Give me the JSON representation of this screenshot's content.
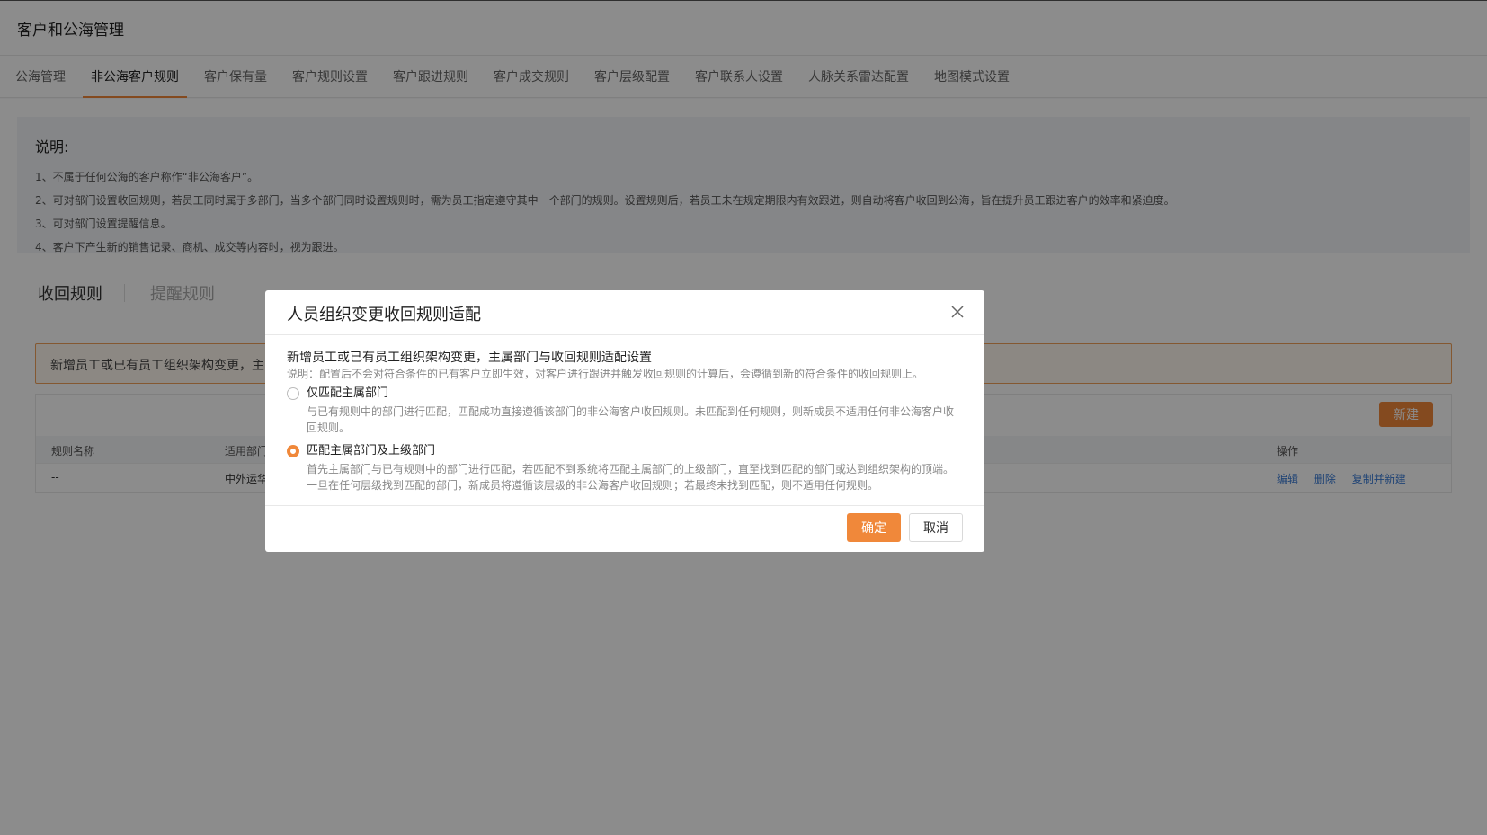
{
  "header": {
    "title": "客户和公海管理"
  },
  "tabs": [
    {
      "label": "公海管理"
    },
    {
      "label": "非公海客户规则",
      "active": true
    },
    {
      "label": "客户保有量"
    },
    {
      "label": "客户规则设置"
    },
    {
      "label": "客户跟进规则"
    },
    {
      "label": "客户成交规则"
    },
    {
      "label": "客户层级配置"
    },
    {
      "label": "客户联系人设置"
    },
    {
      "label": "人脉关系雷达配置"
    },
    {
      "label": "地图模式设置"
    }
  ],
  "notice": {
    "title": "说明:",
    "lines": [
      "1、不属于任何公海的客户称作“非公海客户”。",
      "2、可对部门设置收回规则，若员工同时属于多部门，当多个部门同时设置规则时，需为员工指定遵守其中一个部门的规则。设置规则后，若员工未在规定期限内有效跟进，则自动将客户收回到公海，旨在提升员工跟进客户的效率和紧迫度。",
      "3、可对部门设置提醒信息。",
      "4、客户下产生新的销售记录、商机、成交等内容时，视为跟进。"
    ]
  },
  "subtabs": {
    "active": "收回规则",
    "inactive": "提醒规则"
  },
  "warn_bar": {
    "text": "新增员工或已有员工组织架构变更，主"
  },
  "table": {
    "new_button": "新建",
    "headers": {
      "name": "规则名称",
      "dept": "适用部门",
      "ops": "操作"
    },
    "row": {
      "name": "--",
      "dept": "中外运华",
      "edit": "编辑",
      "delete": "删除",
      "copy": "复制并新建"
    }
  },
  "modal": {
    "title": "人员组织变更收回规则适配",
    "section_title": "新增员工或已有员工组织架构变更，主属部门与收回规则适配设置",
    "section_desc": "说明：配置后不会对符合条件的已有客户立即生效，对客户进行跟进并触发收回规则的计算后，会遵循到新的符合条件的收回规则上。",
    "options": [
      {
        "label": "仅匹配主属部门",
        "desc": "与已有规则中的部门进行匹配，匹配成功直接遵循该部门的非公海客户收回规则。未匹配到任何规则，则新成员不适用任何非公海客户收回规则。",
        "checked": false
      },
      {
        "label": "匹配主属部门及上级部门",
        "desc": "首先主属部门与已有规则中的部门进行匹配，若匹配不到系统将匹配主属部门的上级部门，直至找到匹配的部门或达到组织架构的顶端。一旦在任何层级找到匹配的部门，新成员将遵循该层级的非公海客户收回规则；若最终未找到匹配，则不适用任何规则。",
        "checked": true
      }
    ],
    "ok_label": "确定",
    "cancel_label": "取消"
  },
  "colors": {
    "accent": "#f0883a",
    "link": "#3a7bd5"
  }
}
